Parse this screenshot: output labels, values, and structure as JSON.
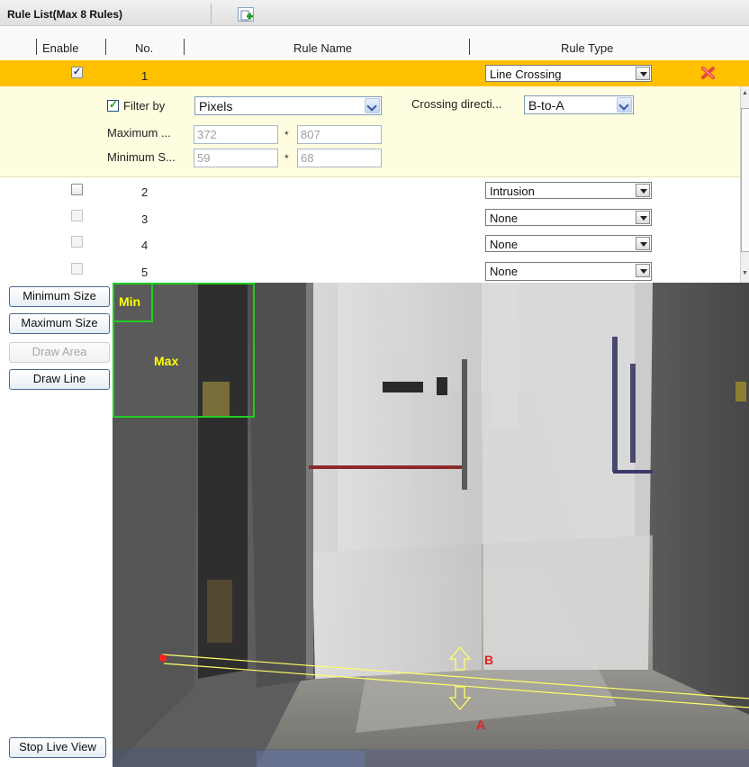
{
  "rule_list": {
    "title": "Rule List(Max 8 Rules)",
    "columns": [
      "Enable",
      "No.",
      "Rule Name",
      "Rule Type"
    ]
  },
  "rows": [
    {
      "enabled": true,
      "no": "1",
      "name": "",
      "type": "Line Crossing",
      "selected": true
    },
    {
      "enabled": false,
      "no": "2",
      "name": "",
      "type": "Intrusion"
    },
    {
      "enabled": false,
      "no": "3",
      "name": "",
      "type": "None"
    },
    {
      "enabled": false,
      "no": "4",
      "name": "",
      "type": "None"
    },
    {
      "enabled": false,
      "no": "5",
      "name": "",
      "type": "None"
    }
  ],
  "detail": {
    "filter_label": "Filter by",
    "filter_checked": true,
    "filter_value": "Pixels",
    "maximum_label": "Maximum ...",
    "maximum_w": "372",
    "maximum_h": "807",
    "minimum_label": "Minimum S...",
    "minimum_w": "59",
    "minimum_h": "68",
    "size_separator": "*",
    "crossing_label": "Crossing directi...",
    "crossing_value": "B-to-A"
  },
  "tools": {
    "minimum_size": "Minimum Size",
    "maximum_size": "Maximum Size",
    "draw_area": "Draw Area",
    "draw_line": "Draw Line",
    "stop_live_view": "Stop Live View"
  },
  "overlay": {
    "min_label": "Min",
    "max_label": "Max",
    "point_b": "B",
    "point_a": "A"
  },
  "colors": {
    "selected_row": "#ffc000",
    "detail_bg": "#fffde0",
    "min_max_box": "#22cc22",
    "overlay_text": "#ffff00",
    "line": "#ffff66",
    "endpoint": "#ff2020"
  },
  "icons": {
    "add_rule": "add-rule-icon",
    "delete_rule": "delete-icon",
    "dropdown": "chevron-down-icon"
  }
}
